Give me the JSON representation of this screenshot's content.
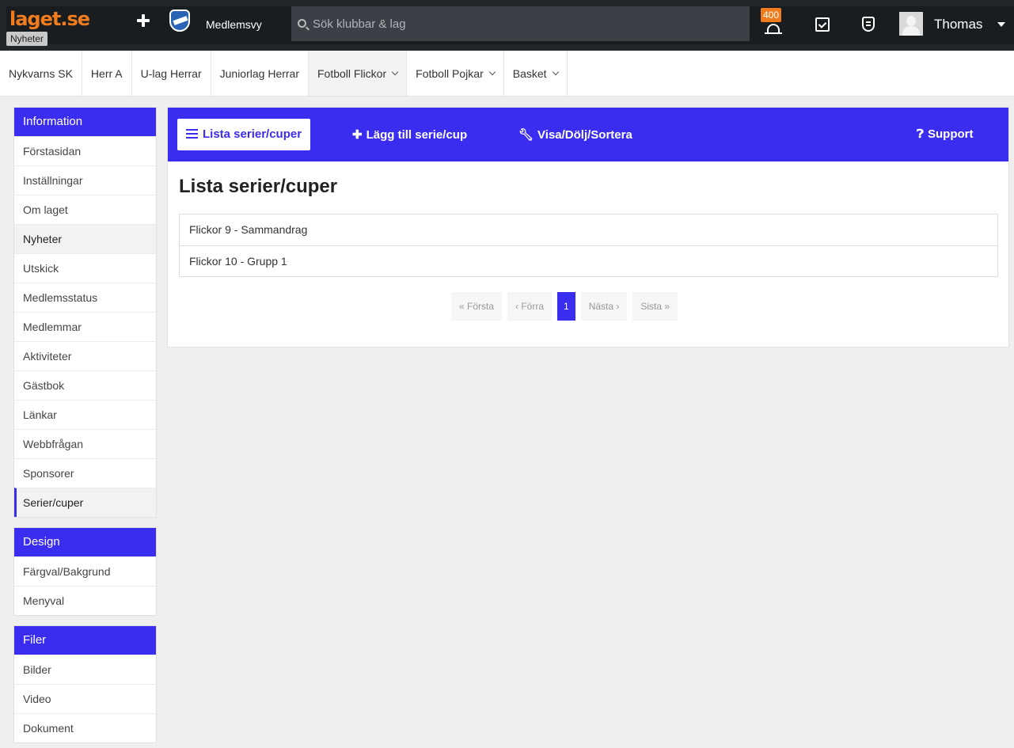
{
  "topbar": {
    "logo_main": "laget",
    "logo_suffix": ".se",
    "tooltip": "Nyheter",
    "club_view_label": "Medlemsvy",
    "search_placeholder": "Sök klubbar & lag",
    "notification_count": "400",
    "username": "Thomas"
  },
  "teamnav": {
    "tabs": [
      {
        "label": "Nykvarns SK"
      },
      {
        "label": "Herr A"
      },
      {
        "label": "U-lag Herrar"
      },
      {
        "label": "Juniorlag Herrar"
      },
      {
        "label": "Fotboll Flickor"
      },
      {
        "label": "Fotboll Pojkar"
      },
      {
        "label": "Basket"
      }
    ]
  },
  "sidebar": {
    "information": {
      "title": "Information",
      "items": [
        "Förstasidan",
        "Inställningar",
        "Om laget",
        "Nyheter",
        "Utskick",
        "Medlemsstatus",
        "Medlemmar",
        "Aktiviteter",
        "Gästbok",
        "Länkar",
        "Webbfrågan",
        "Sponsorer",
        "Serier/cuper"
      ]
    },
    "design": {
      "title": "Design",
      "items": [
        "Färgval/Bakgrund",
        "Menyval"
      ]
    },
    "filer": {
      "title": "Filer",
      "items": [
        "Bilder",
        "Video",
        "Dokument"
      ]
    }
  },
  "actions": {
    "list": "Lista serier/cuper",
    "add": "Lägg till serie/cup",
    "manage": "Visa/Dölj/Sortera",
    "support": "Support"
  },
  "main": {
    "title": "Lista serier/cuper",
    "items": [
      "Flickor 9 - Sammandrag",
      "Flickor 10 - Grupp 1"
    ]
  },
  "pager": {
    "first": "« Första",
    "prev": "‹ Förra",
    "current": "1",
    "next": "Nästa ›",
    "last": "Sista »"
  }
}
